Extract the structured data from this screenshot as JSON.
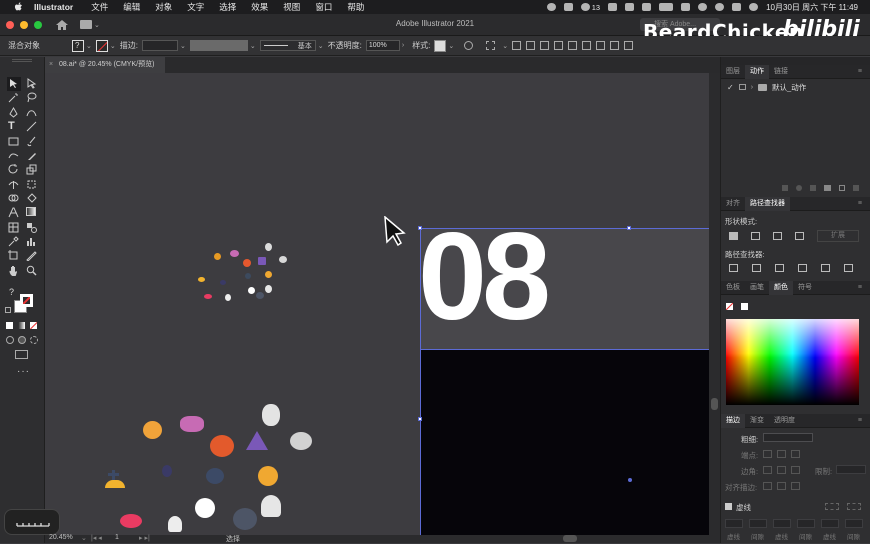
{
  "menubar": {
    "app_name": "Illustrator",
    "items": [
      "文件",
      "编辑",
      "对象",
      "文字",
      "选择",
      "效果",
      "视图",
      "窗口",
      "帮助"
    ],
    "notification_count": "13",
    "clock": "10月30日 周六 下午 11:49"
  },
  "window": {
    "title": "Adobe Illustrator 2021",
    "search_placeholder": "搜索 Adobe...",
    "traffic_lights": [
      "#ff5f57",
      "#febc2e",
      "#28c840"
    ]
  },
  "watermark": {
    "channel": "BeardChicken",
    "logo": "bilibili"
  },
  "controlbar": {
    "object_type": "混合对象",
    "stroke_label": "描边:",
    "stroke_style": "基本",
    "opacity_label": "不透明度:",
    "opacity_value": "100%",
    "style_label": "样式:"
  },
  "document_tab": {
    "label": "08.ai* @ 20.45% (CMYK/预览)"
  },
  "canvas": {
    "artboard_text": "08",
    "accent": "#5c6bd6"
  },
  "statusbar": {
    "zoom": "20.45%",
    "page": "1",
    "tool": "选择"
  },
  "panels": {
    "top_tabs": [
      "图层",
      "动作",
      "链接"
    ],
    "top_active": "动作",
    "action_set": "默认_动作",
    "pathfinder_tabs": [
      "对齐",
      "路径查找器"
    ],
    "pathfinder_active": "路径查找器",
    "shape_modes_label": "形状模式:",
    "expand_label": "扩展",
    "pathfinders_label": "路径查找器:",
    "color_tabs": [
      "色板",
      "画笔",
      "颜色",
      "符号"
    ],
    "color_active": "颜色",
    "stroke_tabs": [
      "描边",
      "渐变",
      "透明度"
    ],
    "stroke_active": "描边",
    "weight_label": "粗细:",
    "cap_label": "端点:",
    "corner_label": "边角:",
    "limit_label": "限制:",
    "align_stroke_label": "对齐描边:",
    "dashed_label": "虚线",
    "dash_labels": [
      "虚线",
      "间隙",
      "虚线",
      "间隙",
      "虚线",
      "间隙"
    ]
  }
}
